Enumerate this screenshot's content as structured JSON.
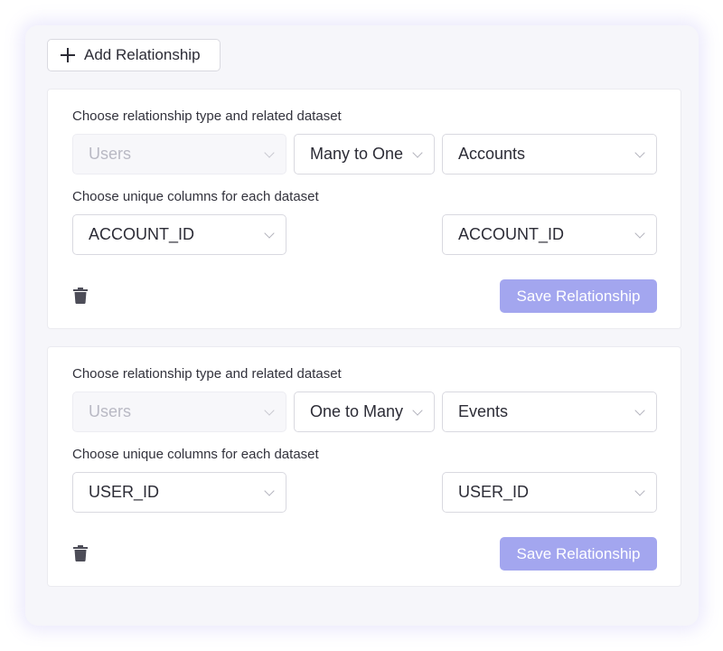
{
  "toolbar": {
    "add_label": "Add Relationship"
  },
  "relationships": [
    {
      "type_label": "Choose relationship type and related dataset",
      "source_dataset": "Users",
      "relationship_type": "Many to One",
      "related_dataset": "Accounts",
      "columns_label": "Choose unique columns for each dataset",
      "source_column": "ACCOUNT_ID",
      "related_column": "ACCOUNT_ID",
      "save_label": "Save Relationship"
    },
    {
      "type_label": "Choose relationship type and related dataset",
      "source_dataset": "Users",
      "relationship_type": "One to Many",
      "related_dataset": "Events",
      "columns_label": "Choose unique columns for each dataset",
      "source_column": "USER_ID",
      "related_column": "USER_ID",
      "save_label": "Save Relationship"
    }
  ],
  "colors": {
    "accent": "#a3a6ef",
    "icon": "#4d4d58",
    "disabled_text": "#b9b9c4"
  },
  "icons": {
    "add": "plus-icon",
    "delete": "trash-icon",
    "dropdown": "chevron-down-icon"
  }
}
